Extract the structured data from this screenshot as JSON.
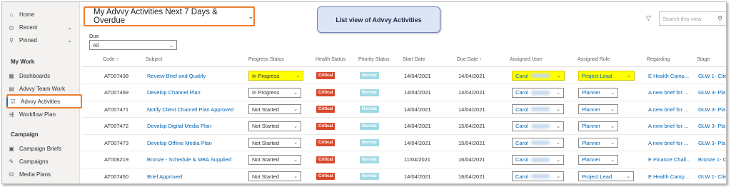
{
  "sidebar": {
    "top": [
      {
        "label": "Home",
        "icon": "home-icon"
      },
      {
        "label": "Recent",
        "icon": "clock-icon"
      },
      {
        "label": "Pinned",
        "icon": "pin-icon"
      }
    ],
    "sections": [
      {
        "title": "My Work",
        "items": [
          {
            "label": "Dashboards",
            "icon": "dashboard-icon"
          },
          {
            "label": "Advvy Team Work",
            "icon": "team-icon"
          },
          {
            "label": "Advvy Activities",
            "icon": "activities-icon"
          },
          {
            "label": "Workflow Plan",
            "icon": "workflow-icon"
          }
        ]
      },
      {
        "title": "Campaign",
        "items": [
          {
            "label": "Campaign Briefs",
            "icon": "briefs-icon"
          },
          {
            "label": "Campaigns",
            "icon": "megaphone-icon"
          },
          {
            "label": "Media Plans",
            "icon": "media-plan-icon"
          }
        ]
      }
    ]
  },
  "header": {
    "view_title": "My Advvy Activities Next 7 Days & Overdue",
    "callout": "List view of Advvy Activities",
    "search_placeholder": "Search this view",
    "due_label": "Due",
    "due_value": "All"
  },
  "table": {
    "columns": [
      "Code ↑",
      "Subject",
      "Progress Status",
      "Health Status",
      "Priority Status",
      "Start Date",
      "Due Date ↑",
      "Assigned User",
      "Assigned Role",
      "Regarding",
      "Stage"
    ],
    "rows": [
      {
        "code": "AT007438",
        "subject": "Review Brief and Qualify",
        "progress": "In Progress",
        "health": "Critical",
        "priority": "Normal",
        "start": "14/04/2021",
        "due": "14/04/2021",
        "user": "Carol",
        "role": "Project Lead",
        "regarding": "E Health Camp...",
        "stage": "GLW 1- Clie",
        "highlight": true
      },
      {
        "code": "AT007469",
        "subject": "Develop Channel Plan",
        "progress": "In Progress",
        "health": "Critical",
        "priority": "Normal",
        "start": "14/04/2021",
        "due": "14/04/2021",
        "user": "Carol",
        "role": "Planner",
        "regarding": "A new brief for ...",
        "stage": "GLW 3- Pla",
        "highlight": false
      },
      {
        "code": "AT007471",
        "subject": "Notify Client Channel Plan Approved",
        "progress": "Not Started",
        "health": "Critical",
        "priority": "Normal",
        "start": "14/04/2021",
        "due": "14/04/2021",
        "user": "Carol",
        "role": "Planner",
        "regarding": "A new brief for ...",
        "stage": "GLW 3- Pla",
        "highlight": false
      },
      {
        "code": "AT007472",
        "subject": "Develop Digital Media Plan",
        "progress": "Not Started",
        "health": "Critical",
        "priority": "Normal",
        "start": "14/04/2021",
        "due": "15/04/2021",
        "user": "Carol",
        "role": "Planner",
        "regarding": "A new brief for ...",
        "stage": "GLW 3- Pla",
        "highlight": false
      },
      {
        "code": "AT007473",
        "subject": "Develop Offline Media Plan",
        "progress": "Not Started",
        "health": "Critical",
        "priority": "Normal",
        "start": "14/04/2021",
        "due": "15/04/2021",
        "user": "Carol",
        "role": "Planner",
        "regarding": "A new brief for ...",
        "stage": "GLW 3- Pla",
        "highlight": false
      },
      {
        "code": "AT006219",
        "subject": "Bronze - Schedule & MBA Supplied",
        "progress": "Not Started",
        "health": "Critical",
        "priority": "Normal",
        "start": "11/04/2021",
        "due": "16/04/2021",
        "user": "Carol",
        "role": "Planner",
        "regarding": "E Finance Chall...",
        "stage": "Bronze 1- C",
        "highlight": false
      },
      {
        "code": "AT007450",
        "subject": "Brief Approved",
        "progress": "Not Started",
        "health": "Critical",
        "priority": "Normal",
        "start": "14/04/2021",
        "due": "16/04/2021",
        "user": "Carol",
        "role": "Project Lead",
        "regarding": "E Health Camp...",
        "stage": "GLW 1- Clie",
        "highlight": false
      }
    ]
  },
  "colors": {
    "accent": "#0078d4",
    "annotation": "#ed7d31",
    "highlight": "#ffff00",
    "critical": "#d9472b",
    "normal": "#9fd9e4"
  }
}
